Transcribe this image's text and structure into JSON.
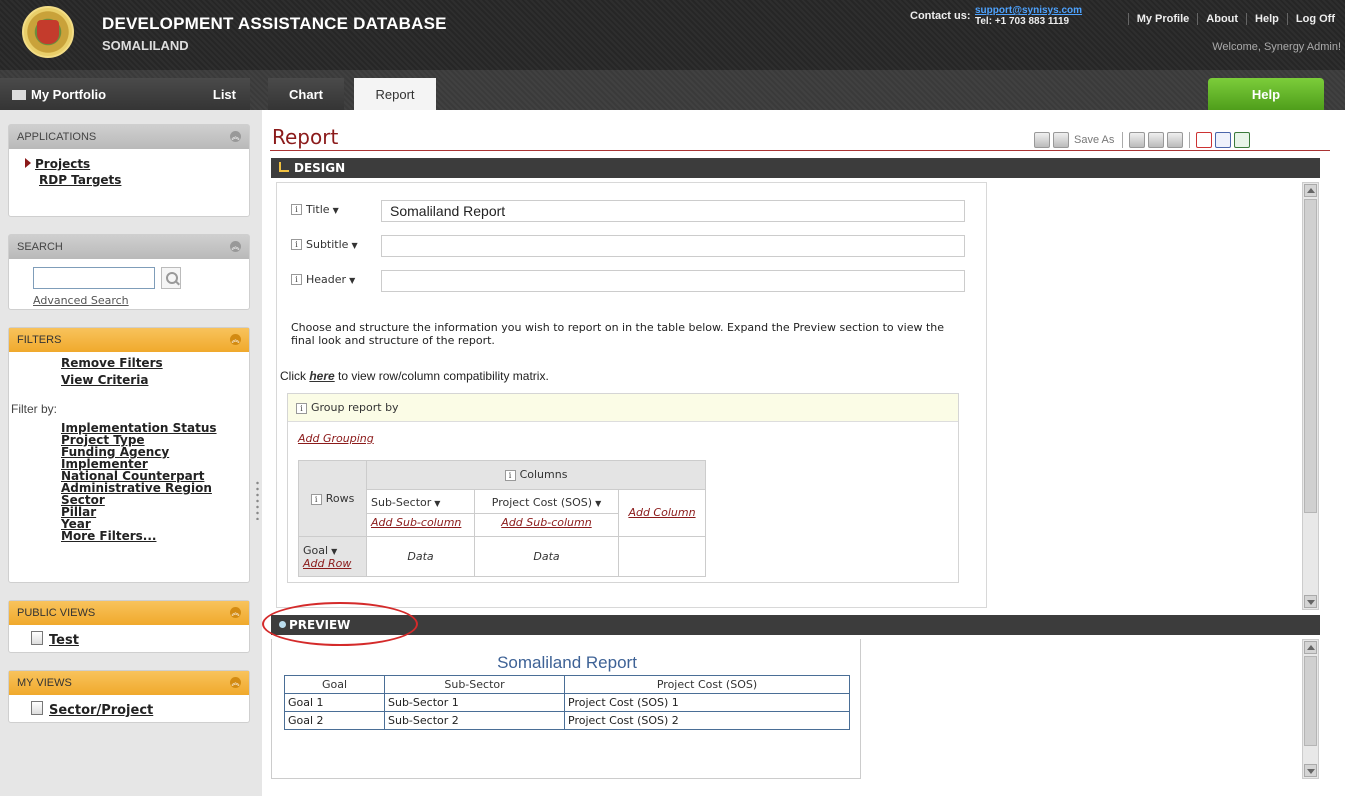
{
  "header": {
    "title": "DEVELOPMENT ASSISTANCE DATABASE",
    "subtitle": "SOMALILAND",
    "contact_label": "Contact us:",
    "contact_email": "support@synisys.com",
    "contact_tel": "Tel: +1 703 883 1119",
    "links": [
      "My Profile",
      "About",
      "Help",
      "Log Off"
    ],
    "welcome": "Welcome, Synergy Admin!"
  },
  "tabs": {
    "portfolio": "My Portfolio",
    "list": "List",
    "chart": "Chart",
    "report": "Report",
    "help": "Help"
  },
  "sidebar": {
    "applications": {
      "title": "APPLICATIONS",
      "items": [
        "Projects",
        "RDP Targets"
      ]
    },
    "search": {
      "title": "SEARCH",
      "value": "",
      "advanced": "Advanced Search"
    },
    "filters": {
      "title": "FILTERS",
      "remove": "Remove Filters",
      "view_criteria": "View Criteria",
      "filter_by": "Filter by:",
      "items": [
        "Implementation Status",
        "Project Type",
        "Funding Agency",
        "Implementer",
        "National Counterpart",
        "Administrative Region",
        "Sector",
        "Pillar",
        "Year",
        "More Filters..."
      ]
    },
    "public_views": {
      "title": "PUBLIC VIEWS",
      "items": [
        "Test"
      ]
    },
    "my_views": {
      "title": "MY VIEWS",
      "items": [
        "Sector/Project"
      ]
    }
  },
  "main": {
    "title": "Report",
    "save_as": "Save As",
    "design": {
      "section": "DESIGN",
      "title_label": "Title",
      "title_value": "Somaliland Report",
      "subtitle_label": "Subtitle",
      "subtitle_value": "",
      "header_label": "Header",
      "header_value": "",
      "instructions": "Choose and structure the information you wish to report on in the table below. Expand the Preview section to view the final look and structure of the report.",
      "click_prefix": "Click",
      "click_here": "here",
      "click_suffix": "to view row/column compatibility matrix.",
      "group_by": "Group report by",
      "add_grouping": "Add Grouping",
      "columns_label": "Columns",
      "rows_label": "Rows",
      "col1": "Sub-Sector",
      "col2": "Project Cost (SOS)",
      "add_subcolumn": "Add Sub-column",
      "add_column": "Add Column",
      "row1": "Goal",
      "add_row": "Add Row",
      "data": "Data"
    },
    "preview": {
      "section": "PREVIEW",
      "report_title": "Somaliland Report",
      "headers": [
        "Goal",
        "Sub-Sector",
        "Project Cost (SOS)"
      ],
      "rows": [
        [
          "Goal 1",
          "Sub-Sector 1",
          "Project Cost (SOS) 1"
        ],
        [
          "Goal 2",
          "Sub-Sector 2",
          "Project Cost (SOS) 2"
        ]
      ]
    }
  }
}
